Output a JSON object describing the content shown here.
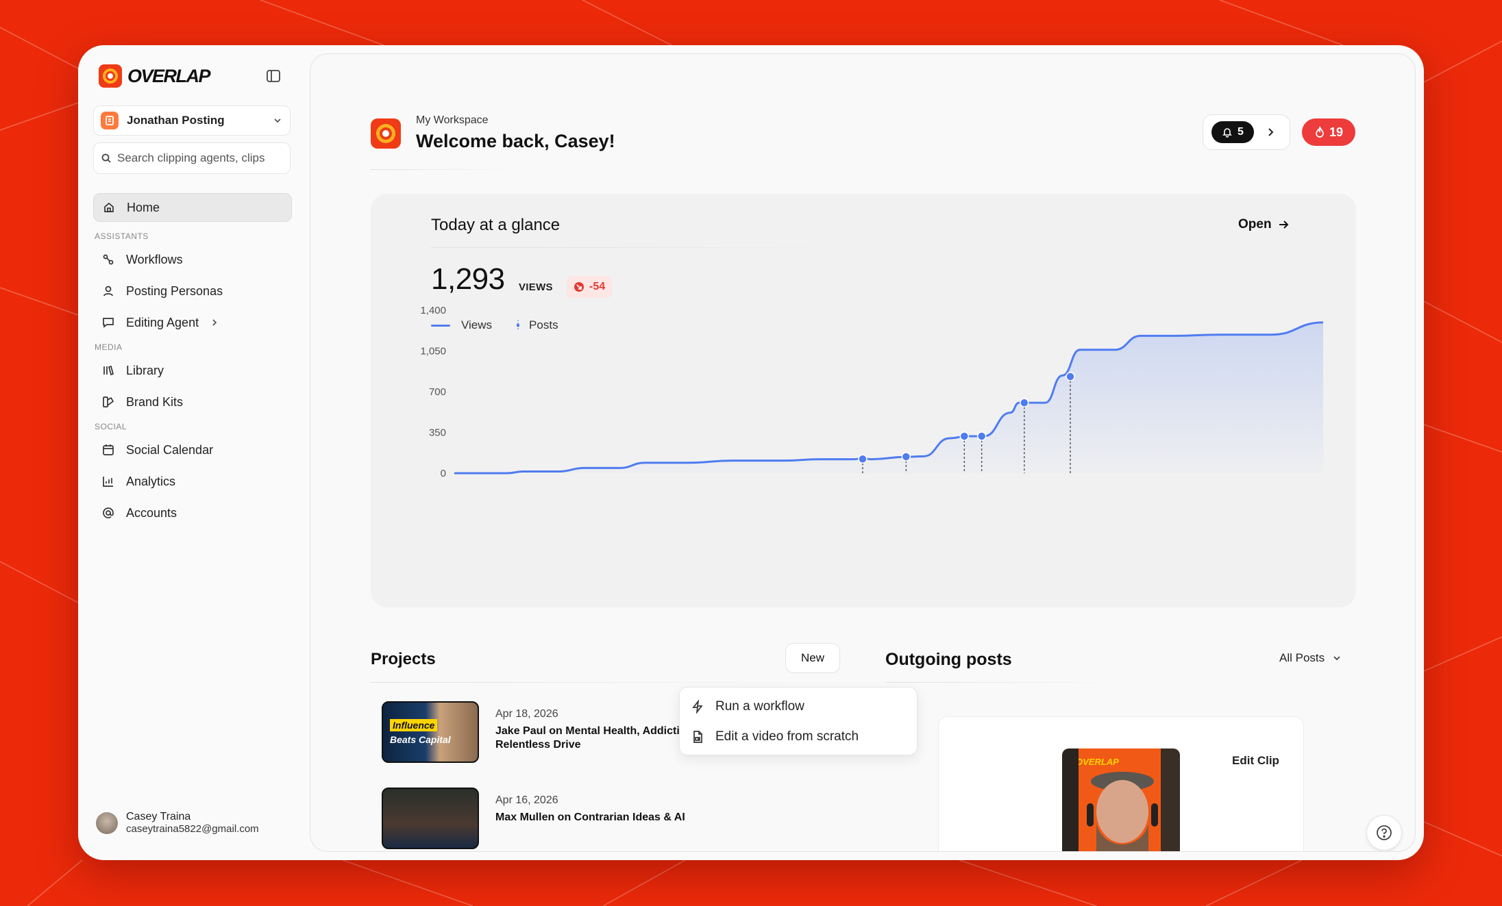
{
  "app": {
    "logo_text": "OVERLAP",
    "brand_color": "#ec2a0a",
    "accent_color": "#4f7cf0"
  },
  "sidebar": {
    "workspace_name": "Jonathan Posting",
    "search_placeholder": "Search clipping agents, clips",
    "home_label": "Home",
    "sections": {
      "assistants": "ASSISTANTS",
      "media": "MEDIA",
      "social": "SOCIAL"
    },
    "items": {
      "workflows": "Workflows",
      "posting_personas": "Posting Personas",
      "editing_agent": "Editing Agent",
      "library": "Library",
      "brand_kits": "Brand Kits",
      "social_calendar": "Social Calendar",
      "analytics": "Analytics",
      "accounts": "Accounts"
    },
    "user": {
      "name": "Casey Traina",
      "email": "caseytraina5822@gmail.com"
    }
  },
  "header": {
    "subtitle": "My Workspace",
    "title": "Welcome back, Casey!",
    "notifications_count": "5",
    "streak_count": "19"
  },
  "glance": {
    "title": "Today at a glance",
    "open_label": "Open",
    "views_value": "1,293",
    "views_label": "VIEWS",
    "delta": "-54",
    "legend_views": "Views",
    "legend_posts": "Posts"
  },
  "chart_data": {
    "type": "area",
    "ylim": [
      0,
      1400
    ],
    "yticks": [
      "0",
      "350",
      "700",
      "1,050",
      "1,400"
    ],
    "ytick_values": [
      0,
      350,
      700,
      1050,
      1400
    ],
    "xlim": [
      0,
      100
    ],
    "grid": false,
    "legend_position": "top-left",
    "series": [
      {
        "name": "Views",
        "color": "#4f7cf0",
        "points": [
          [
            0,
            0
          ],
          [
            6,
            0
          ],
          [
            8,
            15
          ],
          [
            12,
            15
          ],
          [
            15,
            45
          ],
          [
            19,
            45
          ],
          [
            22,
            90
          ],
          [
            27,
            90
          ],
          [
            32,
            108
          ],
          [
            38,
            108
          ],
          [
            42,
            120
          ],
          [
            46,
            120
          ],
          [
            47,
            128
          ],
          [
            48,
            120
          ],
          [
            52,
            140
          ],
          [
            54,
            145
          ],
          [
            57,
            300
          ],
          [
            59,
            318
          ],
          [
            61,
            318
          ],
          [
            64,
            520
          ],
          [
            65,
            605
          ],
          [
            68,
            605
          ],
          [
            70,
            840
          ],
          [
            72,
            1060
          ],
          [
            76,
            1060
          ],
          [
            79,
            1180
          ],
          [
            83,
            1180
          ],
          [
            88,
            1190
          ],
          [
            94,
            1190
          ],
          [
            100,
            1295
          ]
        ]
      }
    ],
    "posts": [
      [
        47,
        122
      ],
      [
        52,
        142
      ],
      [
        58.7,
        318
      ],
      [
        60.7,
        318
      ],
      [
        65.6,
        605
      ],
      [
        70.9,
        830
      ]
    ]
  },
  "projects": {
    "title": "Projects",
    "new_label": "New",
    "menu": {
      "run_workflow": "Run a workflow",
      "edit_scratch": "Edit a video from scratch"
    },
    "items": [
      {
        "date": "Apr 18, 2026",
        "title": "Jake Paul on Mental Health, Addiction & Relentless Drive",
        "thumb_text_1": "Influence",
        "thumb_text_2": "Beats Capital"
      },
      {
        "date": "Apr 16, 2026",
        "title": "Max Mullen on Contrarian Ideas & AI"
      }
    ]
  },
  "outgoing": {
    "title": "Outgoing posts",
    "filter_label": "All Posts",
    "post": {
      "action_label": "Edit Clip",
      "thumb_logo": "OVERLAP"
    }
  }
}
